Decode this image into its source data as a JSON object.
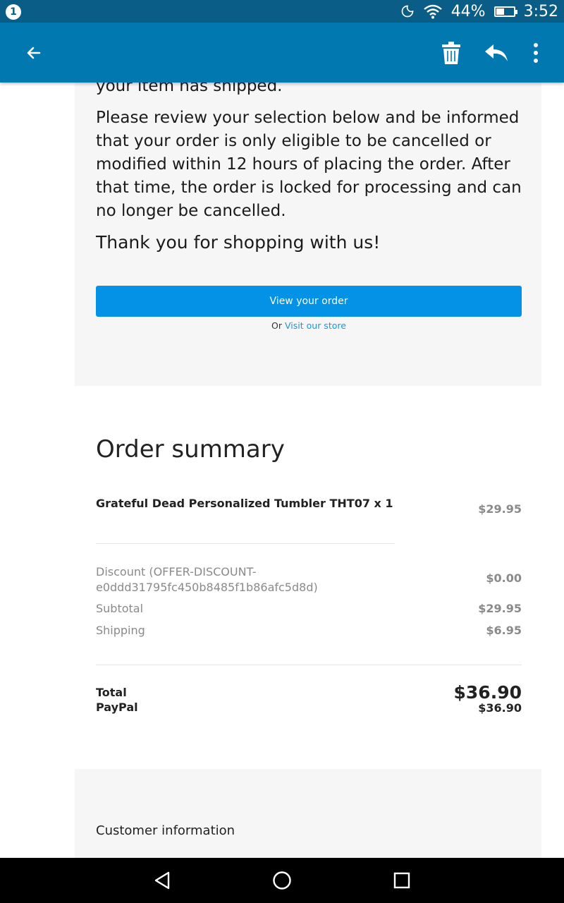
{
  "status_bar": {
    "notification_count": "1",
    "battery": "44%",
    "battery_level": 0.44,
    "time": "3:52",
    "icons": [
      "moon-icon",
      "wifi-icon",
      "battery-icon"
    ]
  },
  "app_bar": {
    "icons": [
      "back-arrow-icon",
      "trash-icon",
      "reply-icon",
      "more-vert-icon"
    ]
  },
  "email": {
    "partial_line": "your item has shipped.",
    "review_text": "Please review your selection below and be informed that your order is only eligible to be cancelled or modified within 12 hours of placing the order. After that time, the order is locked for processing and can no longer be cancelled.",
    "thanks_text": "Thank you for shopping with us!",
    "view_order_button": "View your order",
    "or_text": "Or",
    "visit_store_link": "Visit our store"
  },
  "order_summary": {
    "title": "Order summary",
    "item": {
      "name": "Grateful Dead Personalized Tumbler THT07 x 1",
      "price": "$29.95"
    },
    "discount": {
      "label": "Discount (OFFER-DISCOUNT-e0ddd31795fc450b8485f1b86afc5d8d)",
      "value": "$0.00"
    },
    "subtotal": {
      "label": "Subtotal",
      "value": "$29.95"
    },
    "shipping": {
      "label": "Shipping",
      "value": "$6.95"
    },
    "total": {
      "label": "Total",
      "value": "$36.90"
    },
    "payment": {
      "label": "PayPal",
      "value": "$36.90"
    }
  },
  "customer_info": {
    "title": "Customer information"
  },
  "colors": {
    "status_bar": "#0a5d86",
    "app_bar": "#0179b0",
    "button": "#0392e5",
    "link": "#1996e0"
  },
  "nav_bar": {
    "icons": [
      "nav-back-icon",
      "nav-home-icon",
      "nav-recents-icon"
    ]
  }
}
